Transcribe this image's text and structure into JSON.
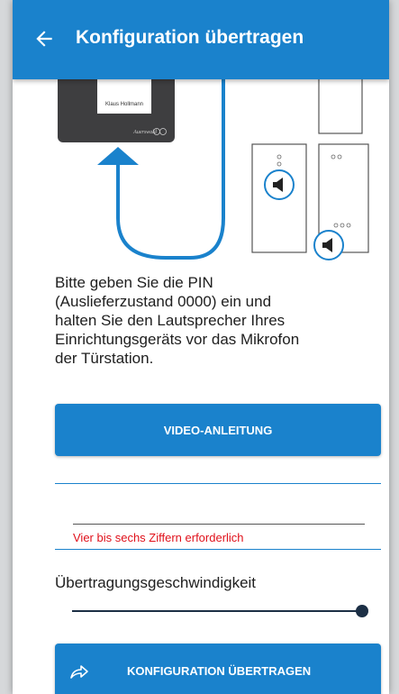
{
  "appbar": {
    "title": "Konfiguration übertragen",
    "back_icon": "arrow-left-icon",
    "color": "#1a82cc"
  },
  "illustration": {
    "device_label": "Klaus Hollmann",
    "brand": "Auerswald"
  },
  "instruction": "Bitte geben Sie die PIN\n(Auslieferzustand 0000) ein und\nhalten Sie den Lautsprecher Ihres\nEinrichtungsgeräts vor das Mikrofon\nder Türstation.",
  "video_button": {
    "label": "VIDEO-ANLEITUNG"
  },
  "pin": {
    "value": "",
    "error": "Vier bis sechs Ziffern erforderlich",
    "error_color": "#e0101a"
  },
  "speed": {
    "label": "Übertragungsgeschwindigkeit",
    "level": 1.0
  },
  "transfer_button": {
    "label": "KONFIGURATION ÜBERTRAGEN",
    "icon": "share-icon"
  }
}
